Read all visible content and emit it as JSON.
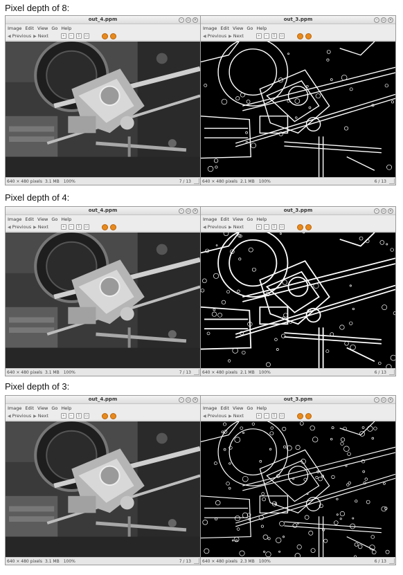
{
  "sections": [
    {
      "heading": "Pixel depth of 8:",
      "left": {
        "title": "out_4.ppm",
        "dims": "640 × 480 pixels",
        "size": "3.1 MB",
        "zoom": "100%",
        "position": "7 / 13"
      },
      "right": {
        "title": "out_3.ppm",
        "dims": "640 × 480 pixels",
        "size": "2.1 MB",
        "zoom": "100%",
        "position": "6 / 13"
      }
    },
    {
      "heading": "Pixel depth of 4:",
      "left": {
        "title": "out_4.ppm",
        "dims": "640 × 480 pixels",
        "size": "3.1 MB",
        "zoom": "100%",
        "position": "7 / 13"
      },
      "right": {
        "title": "out_3.ppm",
        "dims": "640 × 480 pixels",
        "size": "2.1 MB",
        "zoom": "100%",
        "position": "6 / 13"
      }
    },
    {
      "heading": "Pixel depth of 3:",
      "left": {
        "title": "out_4.ppm",
        "dims": "640 × 480 pixels",
        "size": "3.1 MB",
        "zoom": "100%",
        "position": "7 / 13"
      },
      "right": {
        "title": "out_3.ppm",
        "dims": "640 × 480 pixels",
        "size": "2.3 MB",
        "zoom": "100%",
        "position": "6 / 13"
      }
    }
  ],
  "menu": [
    "Image",
    "Edit",
    "View",
    "Go",
    "Help"
  ],
  "toolbar": {
    "previous": "Previous",
    "next": "Next"
  },
  "icons": {
    "previous": "arrow-left-icon",
    "next": "arrow-right-icon",
    "zoom_in": "zoom-in-icon",
    "zoom_out": "zoom-out-icon",
    "zoom_fit": "zoom-fit-icon",
    "zoom_normal": "zoom-normal-icon",
    "rotate_left": "rotate-left-icon",
    "rotate_right": "rotate-right-icon",
    "minimize": "minimize-icon",
    "maximize": "maximize-icon",
    "close": "close-icon"
  },
  "colors": {
    "rotate_accent": "#e88a1c",
    "window_bg": "#ececec"
  }
}
